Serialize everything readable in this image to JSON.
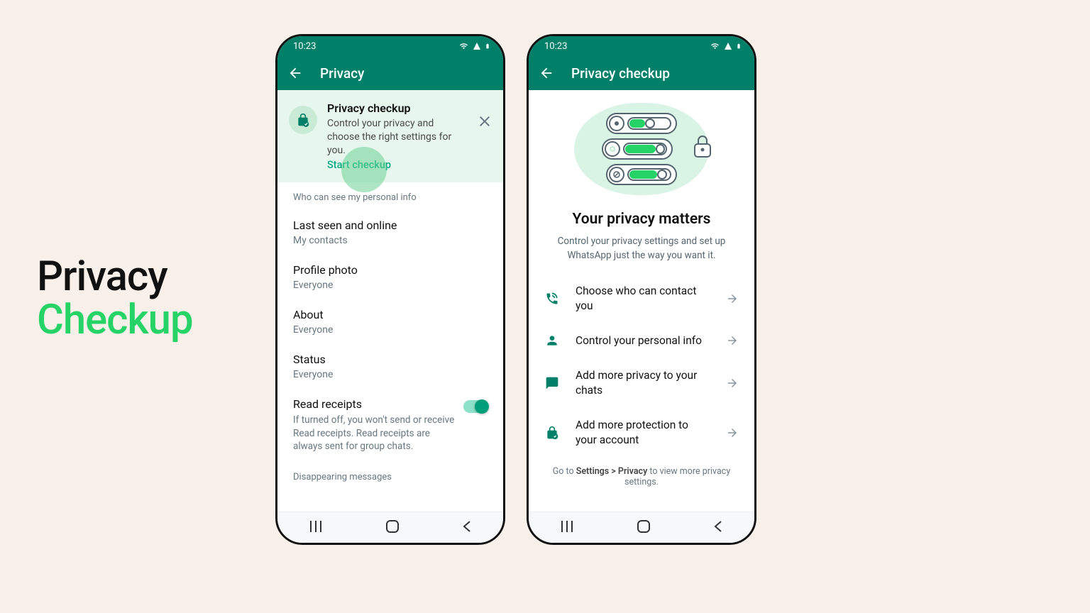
{
  "hero": {
    "line1": "Privacy",
    "line2": "Checkup"
  },
  "statusTime": "10:23",
  "screen1": {
    "title": "Privacy",
    "banner": {
      "title": "Privacy checkup",
      "desc": "Control your privacy and choose the right settings for you.",
      "cta": "Start checkup"
    },
    "sectionHeader": "Who can see my personal info",
    "items": [
      {
        "label": "Last seen and online",
        "value": "My contacts"
      },
      {
        "label": "Profile photo",
        "value": "Everyone"
      },
      {
        "label": "About",
        "value": "Everyone"
      },
      {
        "label": "Status",
        "value": "Everyone"
      }
    ],
    "readReceipts": {
      "label": "Read receipts",
      "helper": "If turned off, you won't send or receive Read receipts. Read receipts are always sent for group chats."
    },
    "section2Header": "Disappearing messages"
  },
  "screen2": {
    "title": "Privacy checkup",
    "heroTitle": "Your privacy matters",
    "heroDesc": "Control your privacy settings and set up WhatsApp just the way you want it.",
    "items": [
      "Choose who can contact you",
      "Control your personal info",
      "Add more privacy to your chats",
      "Add more protection to your account"
    ],
    "footnotePrefix": "Go to ",
    "footnotePath": "Settings > Privacy",
    "footnoteSuffix": " to view more privacy settings."
  }
}
